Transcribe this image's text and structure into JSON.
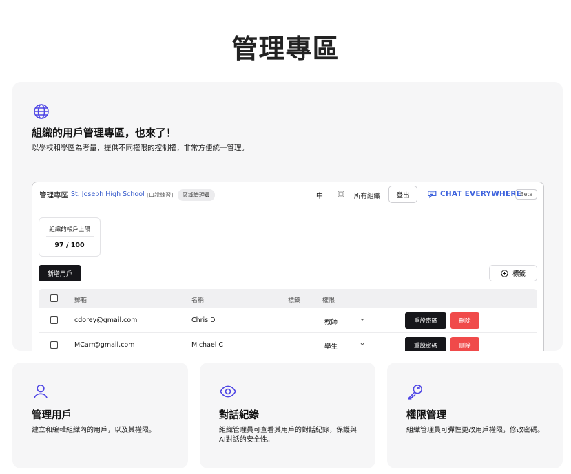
{
  "page": {
    "title": "管理專區"
  },
  "hero": {
    "icon": "globe-icon",
    "heading": "組織的用戶管理專區，也來了！",
    "description": "以學校和學區為考量，提供不同權限的控制權，非常方便統一管理。"
  },
  "app": {
    "header": {
      "title": "管理專區",
      "school": "St. Joseph High School",
      "demo_tag": "[口說練習]",
      "role_badge": "區域管理員",
      "language": "中",
      "theme_icon": "sun-icon",
      "org_selector": "所有組織",
      "logout_label": "登出",
      "brand": "CHAT EVERYWHERE",
      "beta_badge": "Beta"
    },
    "quota": {
      "label": "組織的帳戶上限",
      "value": "97 / 100"
    },
    "add_user_label": "新增用戶",
    "tags_label": "標籤",
    "table": {
      "columns": {
        "email": "郵箱",
        "name": "名稱",
        "tags": "標籤",
        "role": "權限"
      },
      "rows": [
        {
          "email": "cdorey@gmail.com",
          "name": "Chris D",
          "role": "教師",
          "reset_label": "重設密碼",
          "delete_label": "刪除"
        },
        {
          "email": "MCarr@gmail.com",
          "name": "Michael C",
          "role": "學生",
          "reset_label": "重設密碼",
          "delete_label": "刪除"
        }
      ]
    }
  },
  "features": [
    {
      "icon": "user-icon",
      "title": "管理用戶",
      "description": "建立和編輯組織內的用戶，以及其權限。"
    },
    {
      "icon": "eye-icon",
      "title": "對話紀錄",
      "description": "組織管理員可查看其用戶的對話紀錄，保護與AI對話的安全性。"
    },
    {
      "icon": "key-icon",
      "title": "權限管理",
      "description": "組織管理員可彈性更改用戶權限，修改密碼。"
    }
  ],
  "colors": {
    "accent": "#3e63dd",
    "icon_purple": "#4f46e5",
    "danger": "#f04a4a",
    "dark_button": "#16161a"
  }
}
